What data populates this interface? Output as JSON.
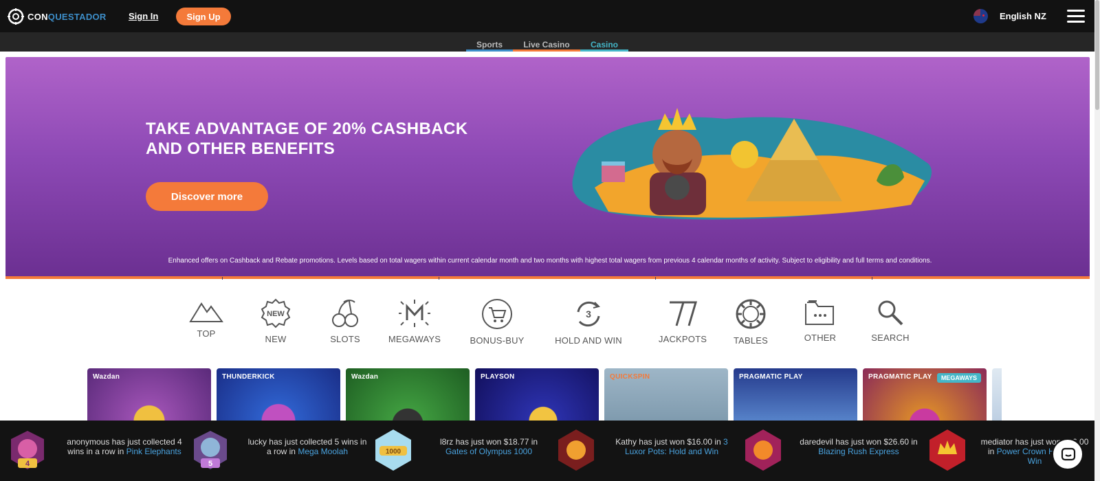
{
  "header": {
    "logo_prefix": "CON",
    "logo_highlight": "QUEST",
    "logo_suffix": "ADOR",
    "sign_in": "Sign In",
    "sign_up": "Sign Up",
    "language": "English NZ"
  },
  "subnav": {
    "tabs": [
      {
        "label": "Sports",
        "color": "#3d8ec9"
      },
      {
        "label": "Live Casino",
        "color": "#f47a3a"
      },
      {
        "label": "Casino",
        "color": "#44b6c8",
        "active": true
      }
    ]
  },
  "banner": {
    "title_line1": "TAKE ADVANTAGE OF 20% CASHBACK",
    "title_line2": "AND OTHER BENEFITS",
    "cta": "Discover more",
    "note": "Enhanced offers on Cashback and Rebate promotions. Levels based on total wagers within current calendar month and two months with highest total wagers from previous 4 calendar months of activity. Subject to eligibility and full terms and conditions."
  },
  "categories": [
    {
      "label": "TOP",
      "icon": "mountain-icon"
    },
    {
      "label": "NEW",
      "icon": "new-badge-icon"
    },
    {
      "label": "SLOTS",
      "icon": "cherries-icon"
    },
    {
      "label": "MEGAWAYS",
      "icon": "megaways-icon"
    },
    {
      "label": "BONUS-BUY",
      "icon": "cart-icon"
    },
    {
      "label": "HOLD AND WIN",
      "icon": "hold-and-win-icon"
    },
    {
      "label": "JACKPOTS",
      "icon": "sevens-icon"
    },
    {
      "label": "TABLES",
      "icon": "chip-icon"
    },
    {
      "label": "OTHER",
      "icon": "folder-icon"
    },
    {
      "label": "SEARCH",
      "icon": "search-icon"
    }
  ],
  "games": [
    {
      "provider": "Wazdan"
    },
    {
      "provider": "THUNDERKICK"
    },
    {
      "provider": "Wazdan"
    },
    {
      "provider": "PLAYSON"
    },
    {
      "provider": "QUICKSPIN"
    },
    {
      "provider": "PRAGMATIC PLAY"
    },
    {
      "provider": "PRAGMATIC PLAY",
      "badge": "MEGAWAYS"
    },
    {
      "provider": ""
    }
  ],
  "ticker": [
    {
      "pre": "anonymous has just collected 4 wins in a row in",
      "game": "Pink Elephants"
    },
    {
      "pre": "lucky has just collected 5 wins in a row in",
      "game": "Mega Moolah"
    },
    {
      "pre": "l8rz has just won $18.77 in",
      "game": "Gates of Olympus 1000"
    },
    {
      "pre": "Kathy has just won $16.00 in",
      "game": "3 Luxor Pots: Hold and Win"
    },
    {
      "pre": "daredevil has just won $26.60 in",
      "game": "Blazing Rush Express"
    },
    {
      "pre": "mediator has just won $86.00 in",
      "game": "Power Crown Hold and Win"
    }
  ],
  "colors": {
    "accent_orange": "#f47a3a",
    "accent_blue": "#3d8ec9",
    "accent_teal": "#44b6c8",
    "banner_purple": "#8d49b5"
  }
}
